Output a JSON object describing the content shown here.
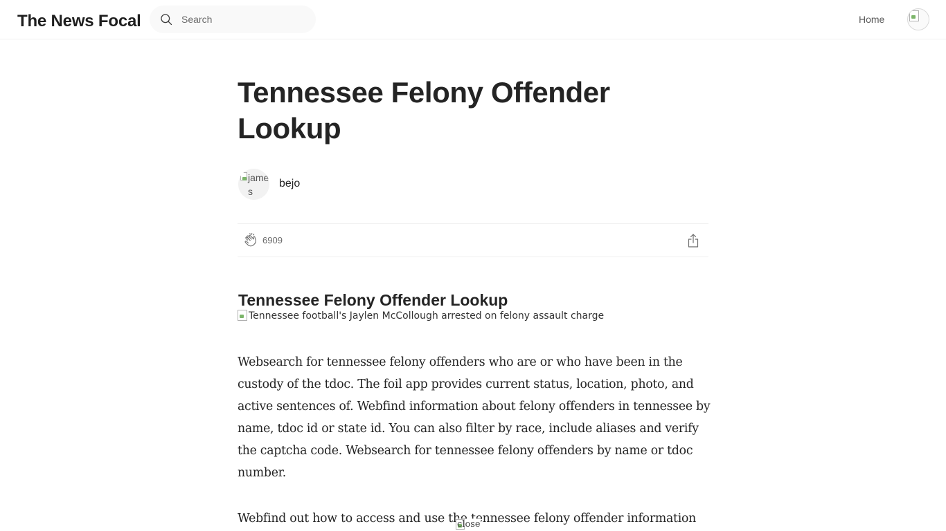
{
  "header": {
    "brand": "The News Focal",
    "search": {
      "placeholder": "Search",
      "icon": "search-icon"
    },
    "nav": {
      "home_label": "Home"
    }
  },
  "article": {
    "title": "Tennessee Felony Offender Lookup",
    "author": {
      "name": "bejo",
      "avatar_alt": "james"
    },
    "actions": {
      "clap_count": "6909",
      "clap_icon": "clap-icon",
      "share_icon": "share-icon"
    },
    "section_heading": "Tennessee Felony Offender Lookup",
    "hero_image_alt": "Tennessee football's Jaylen McCollough arrested on felony assault charge",
    "paragraphs": [
      "Websearch for tennessee felony offenders who are or who have been in the custody of the tdoc. The foil app provides current status, location, photo, and active sentences of. Webfind information about felony offenders in tennessee by name, tdoc id or state id. You can also filter by race, include aliases and verify the captcha code. Websearch for tennessee felony offenders by name or tdoc number.",
      "Webfind out how to access and use the tennessee felony offender information"
    ],
    "close_image_alt": "close"
  }
}
